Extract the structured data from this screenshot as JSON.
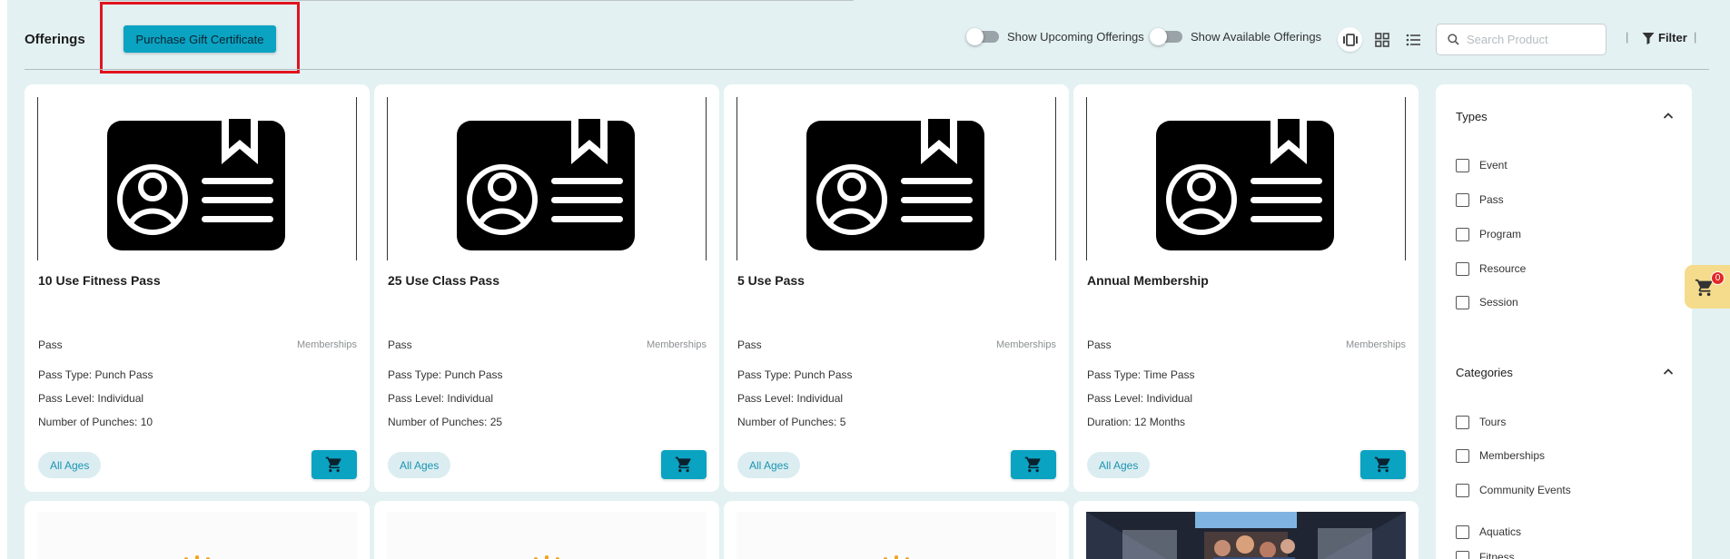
{
  "header": {
    "title": "Offerings",
    "gift_button": "Purchase Gift Certificate",
    "toggle_upcoming": "Show Upcoming Offerings",
    "toggle_available": "Show Available Offerings",
    "search_placeholder": "Search Product",
    "separator": "|",
    "filter_label": "Filter",
    "views": [
      "carousel-view-icon",
      "grid-view-icon",
      "list-view-icon"
    ],
    "active_view": "carousel-view-icon"
  },
  "cards": [
    {
      "name": "10 Use Fitness Pass",
      "type": "Pass",
      "category": "Memberships",
      "details": [
        "Pass Type: Punch Pass",
        "Pass Level: Individual",
        "Number of Punches: 10"
      ],
      "age": "All Ages"
    },
    {
      "name": "25 Use Class Pass",
      "type": "Pass",
      "category": "Memberships",
      "details": [
        "Pass Type: Punch Pass",
        "Pass Level: Individual",
        "Number of Punches: 25"
      ],
      "age": "All Ages"
    },
    {
      "name": "5 Use Pass",
      "type": "Pass",
      "category": "Memberships",
      "details": [
        "Pass Type: Punch Pass",
        "Pass Level: Individual",
        "Number of Punches: 5"
      ],
      "age": "All Ages"
    },
    {
      "name": "Annual Membership",
      "type": "Pass",
      "category": "Memberships",
      "details": [
        "Pass Type: Time Pass",
        "Pass Level: Individual",
        "Duration: 12 Months"
      ],
      "age": "All Ages"
    }
  ],
  "filters": {
    "types_title": "Types",
    "types": [
      "Event",
      "Pass",
      "Program",
      "Resource",
      "Session"
    ],
    "categories_title": "Categories",
    "categories": [
      "Tours",
      "Memberships",
      "Community Events",
      "Aquatics",
      "Fitness"
    ]
  },
  "cart": {
    "count": "0"
  },
  "colors": {
    "accent": "#0aa3c2",
    "background": "#e3f1f3",
    "highlight": "#e0141e",
    "cart_tab": "#f4dc8c",
    "badge": "#e32727"
  }
}
